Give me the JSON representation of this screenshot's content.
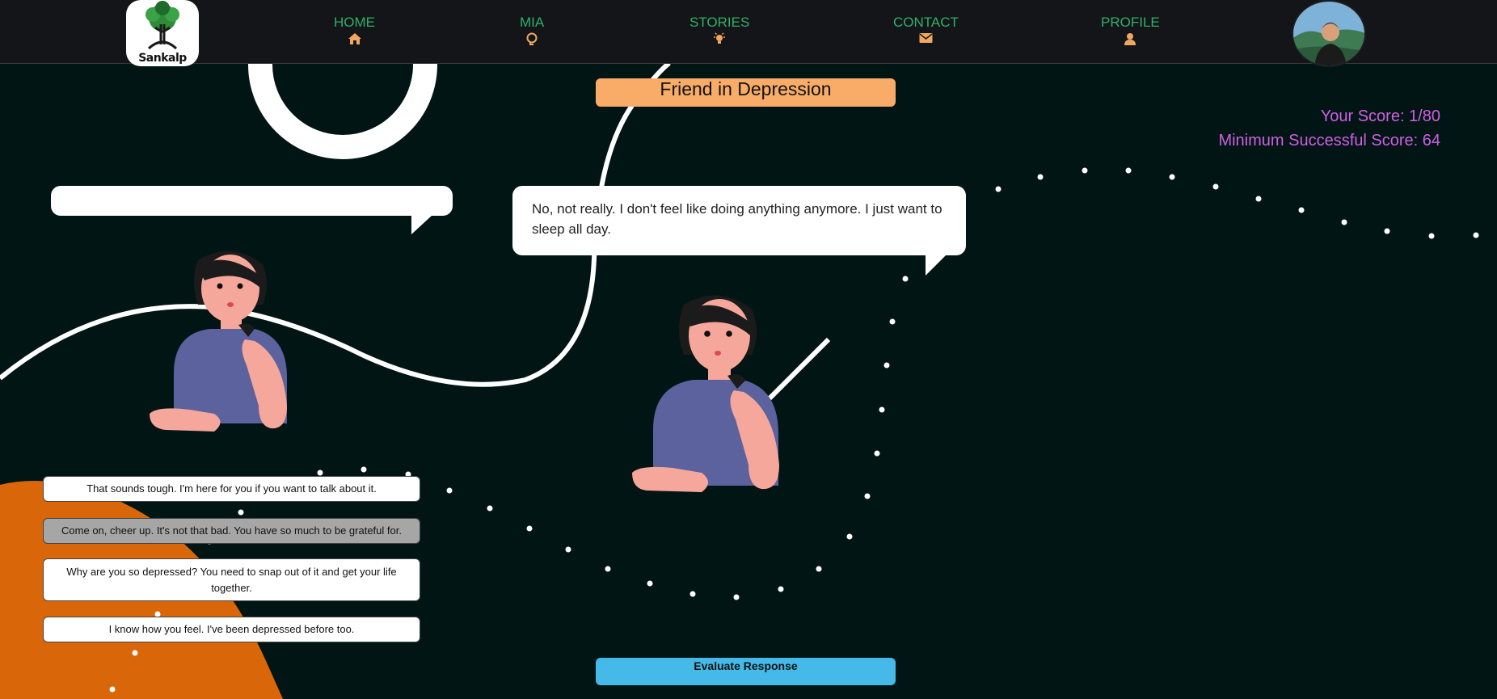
{
  "brand": {
    "logo_text": "Sankalp"
  },
  "nav": {
    "items": [
      {
        "label": "HOME",
        "icon": "home-icon"
      },
      {
        "label": "MIA",
        "icon": "brain-icon"
      },
      {
        "label": "STORIES",
        "icon": "lightbulb-icon"
      },
      {
        "label": "CONTACT",
        "icon": "envelope-icon"
      },
      {
        "label": "PROFILE",
        "icon": "user-icon"
      }
    ],
    "color": "#2fb06a"
  },
  "scenario": {
    "title": "Friend in Depression"
  },
  "score": {
    "current": "Your Score: 1/80",
    "minimum": "Minimum Successful Score: 64"
  },
  "dialogue": {
    "user_bubble": "",
    "friend_bubble": "No, not really. I don't feel like doing anything anymore. I just want to sleep all day."
  },
  "options": [
    {
      "text": "That sounds tough. I'm here for you if you want to talk about it.",
      "selected": false
    },
    {
      "text": "Come on, cheer up. It's not that bad. You have so much to be grateful for.",
      "selected": true
    },
    {
      "text": "Why are you so depressed? You need to snap out of it and get your life together.",
      "selected": false
    },
    {
      "text": "I know how you feel. I've been depressed before too.",
      "selected": false
    }
  ],
  "actions": {
    "evaluate": "Evaluate Response"
  },
  "colors": {
    "background": "#021515",
    "title": "#f8ac68",
    "score": "#cf5fe3",
    "evaluate": "#45b9e8",
    "accent_orange": "#d9670a"
  }
}
